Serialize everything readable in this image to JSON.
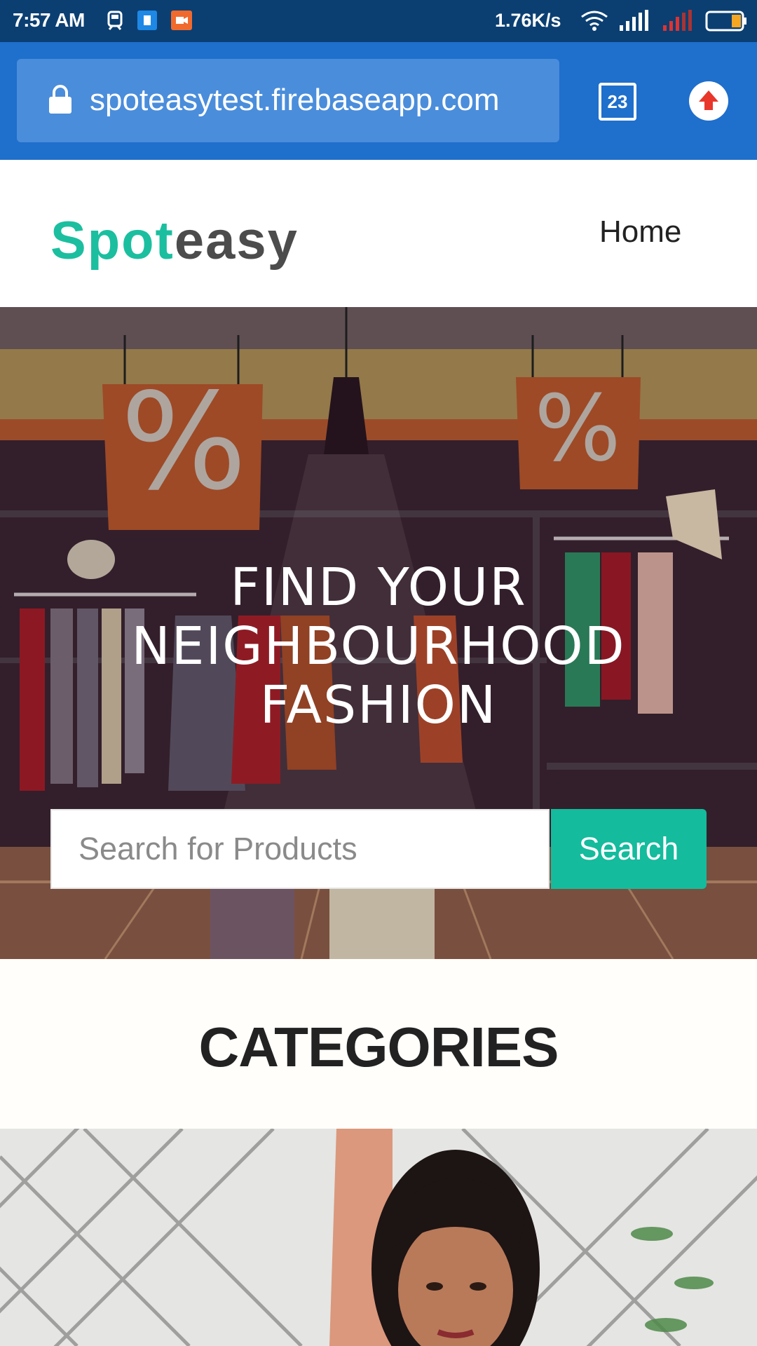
{
  "status_bar": {
    "time": "7:57 AM",
    "net_speed": "1.76K/s",
    "icons": [
      "train-icon",
      "notification-app-icon",
      "video-app-icon",
      "wifi-icon",
      "signal-icon",
      "signal-icon-2",
      "battery-icon"
    ]
  },
  "browser": {
    "url": "spoteasytest.firebaseapp.com",
    "tab_count": "23"
  },
  "header": {
    "logo_part1": "Spot",
    "logo_part2": "easy",
    "nav_home": "Home"
  },
  "hero": {
    "title_line1": "FIND YOUR",
    "title_line2": "NEIGHBOURHOOD",
    "title_line3": "FASHION",
    "search_placeholder": "Search for Products",
    "search_button": "Search"
  },
  "categories": {
    "title": "CATEGORIES"
  },
  "colors": {
    "status_bar": "#0b3f72",
    "browser_bar": "#1f6fcc",
    "brand_green": "#14bb9d",
    "logo_gray": "#4c4c4c"
  }
}
